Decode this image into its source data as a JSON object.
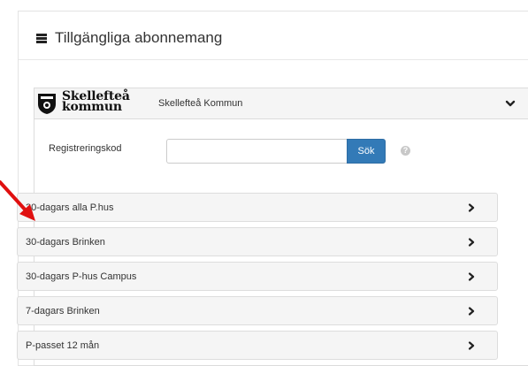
{
  "header": {
    "icon": "server-list-icon",
    "title": "Tillgängliga abonnemang"
  },
  "provider": {
    "logo_line1": "Skellefteå",
    "logo_line2": "kommun",
    "name": "Skellefteå Kommun",
    "toggle_icon": "chevron-down-icon"
  },
  "registration": {
    "label": "Registreringskod",
    "value": "",
    "placeholder": "",
    "search_label": "Sök",
    "help_icon": "question-circle-icon",
    "help_glyph": "?"
  },
  "subscriptions": [
    {
      "label": "30-dagars alla P.hus"
    },
    {
      "label": "30-dagars Brinken"
    },
    {
      "label": "30-dagars P-hus Campus"
    },
    {
      "label": "7-dagars Brinken"
    },
    {
      "label": "P-passet 12 mån"
    }
  ],
  "colors": {
    "primary_button": "#337ab7",
    "annotation_arrow": "#e01010",
    "item_background": "#f5f5f5"
  }
}
